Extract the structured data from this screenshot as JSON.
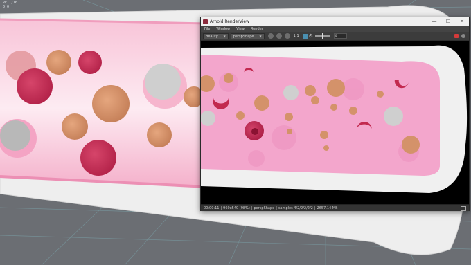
{
  "viewport": {
    "readout_line1": "VE:1/16",
    "readout_line2": "0:0"
  },
  "render_view": {
    "window_title": "Arnold RenderView",
    "window_controls": {
      "minimize": "—",
      "maximize": "☐",
      "close": "✕"
    },
    "menu": [
      "File",
      "Window",
      "View",
      "Render"
    ],
    "toolbar": {
      "aov_select": "Beauty",
      "camera_select": "perspShape",
      "ratio_label": "1:1",
      "exposure_value": "0"
    },
    "status": {
      "time": "00:00:11",
      "resolution": "960x540 (98%)",
      "camera": "perspShape",
      "samples": "samples 4/2/2/2/2/2",
      "memory": "2657.14 MB"
    }
  },
  "colors": {
    "vessel_pink": "#f5b3cc",
    "red_cell": "#c2294f",
    "tan_cell": "#d4926a",
    "white_cell": "#c9c9c9",
    "bone_white": "#f2f2f2"
  },
  "icons": [
    "app-icon",
    "chevron-down-icon",
    "render-icon",
    "stop-icon",
    "refresh-icon",
    "region-icon",
    "gear-icon",
    "snapshot-icon",
    "display-icon"
  ]
}
